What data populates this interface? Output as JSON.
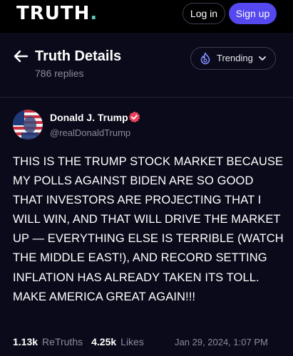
{
  "topbar": {
    "logo_text": "TRUTH",
    "logo_dot": ".",
    "login_label": "Log in",
    "signup_label": "Sign up",
    "accent_color": "#5448ee",
    "logo_dot_color": "#5ad0b5"
  },
  "header": {
    "back_icon": "arrow-left-icon",
    "title": "Truth Details",
    "replies": "786 replies",
    "sort": {
      "icon": "flame-icon",
      "label": "Trending",
      "chevron_icon": "chevron-down-icon"
    }
  },
  "post": {
    "author": {
      "name": "Donald J. Trump",
      "handle": "@realDonaldTrump",
      "verified_icon": "verified-badge-icon",
      "verified_color": "#e8435a"
    },
    "body": "THIS IS THE TRUMP STOCK MARKET BECAUSE MY POLLS AGAINST BIDEN ARE SO GOOD THAT INVESTORS ARE PROJECTING THAT I WILL WIN, AND THAT WILL DRIVE THE MARKET UP — EVERYTHING ELSE IS TERRIBLE (WATCH THE MIDDLE EAST!), AND RECORD SETTING INFLATION HAS ALREADY TAKEN ITS TOLL. MAKE AMERICA GREAT AGAIN!!!",
    "stats": {
      "retruths_count": "1.13k",
      "retruths_label": "ReTruths",
      "likes_count": "4.25k",
      "likes_label": "Likes"
    },
    "timestamp": "Jan 29, 2024, 1:07 PM"
  }
}
